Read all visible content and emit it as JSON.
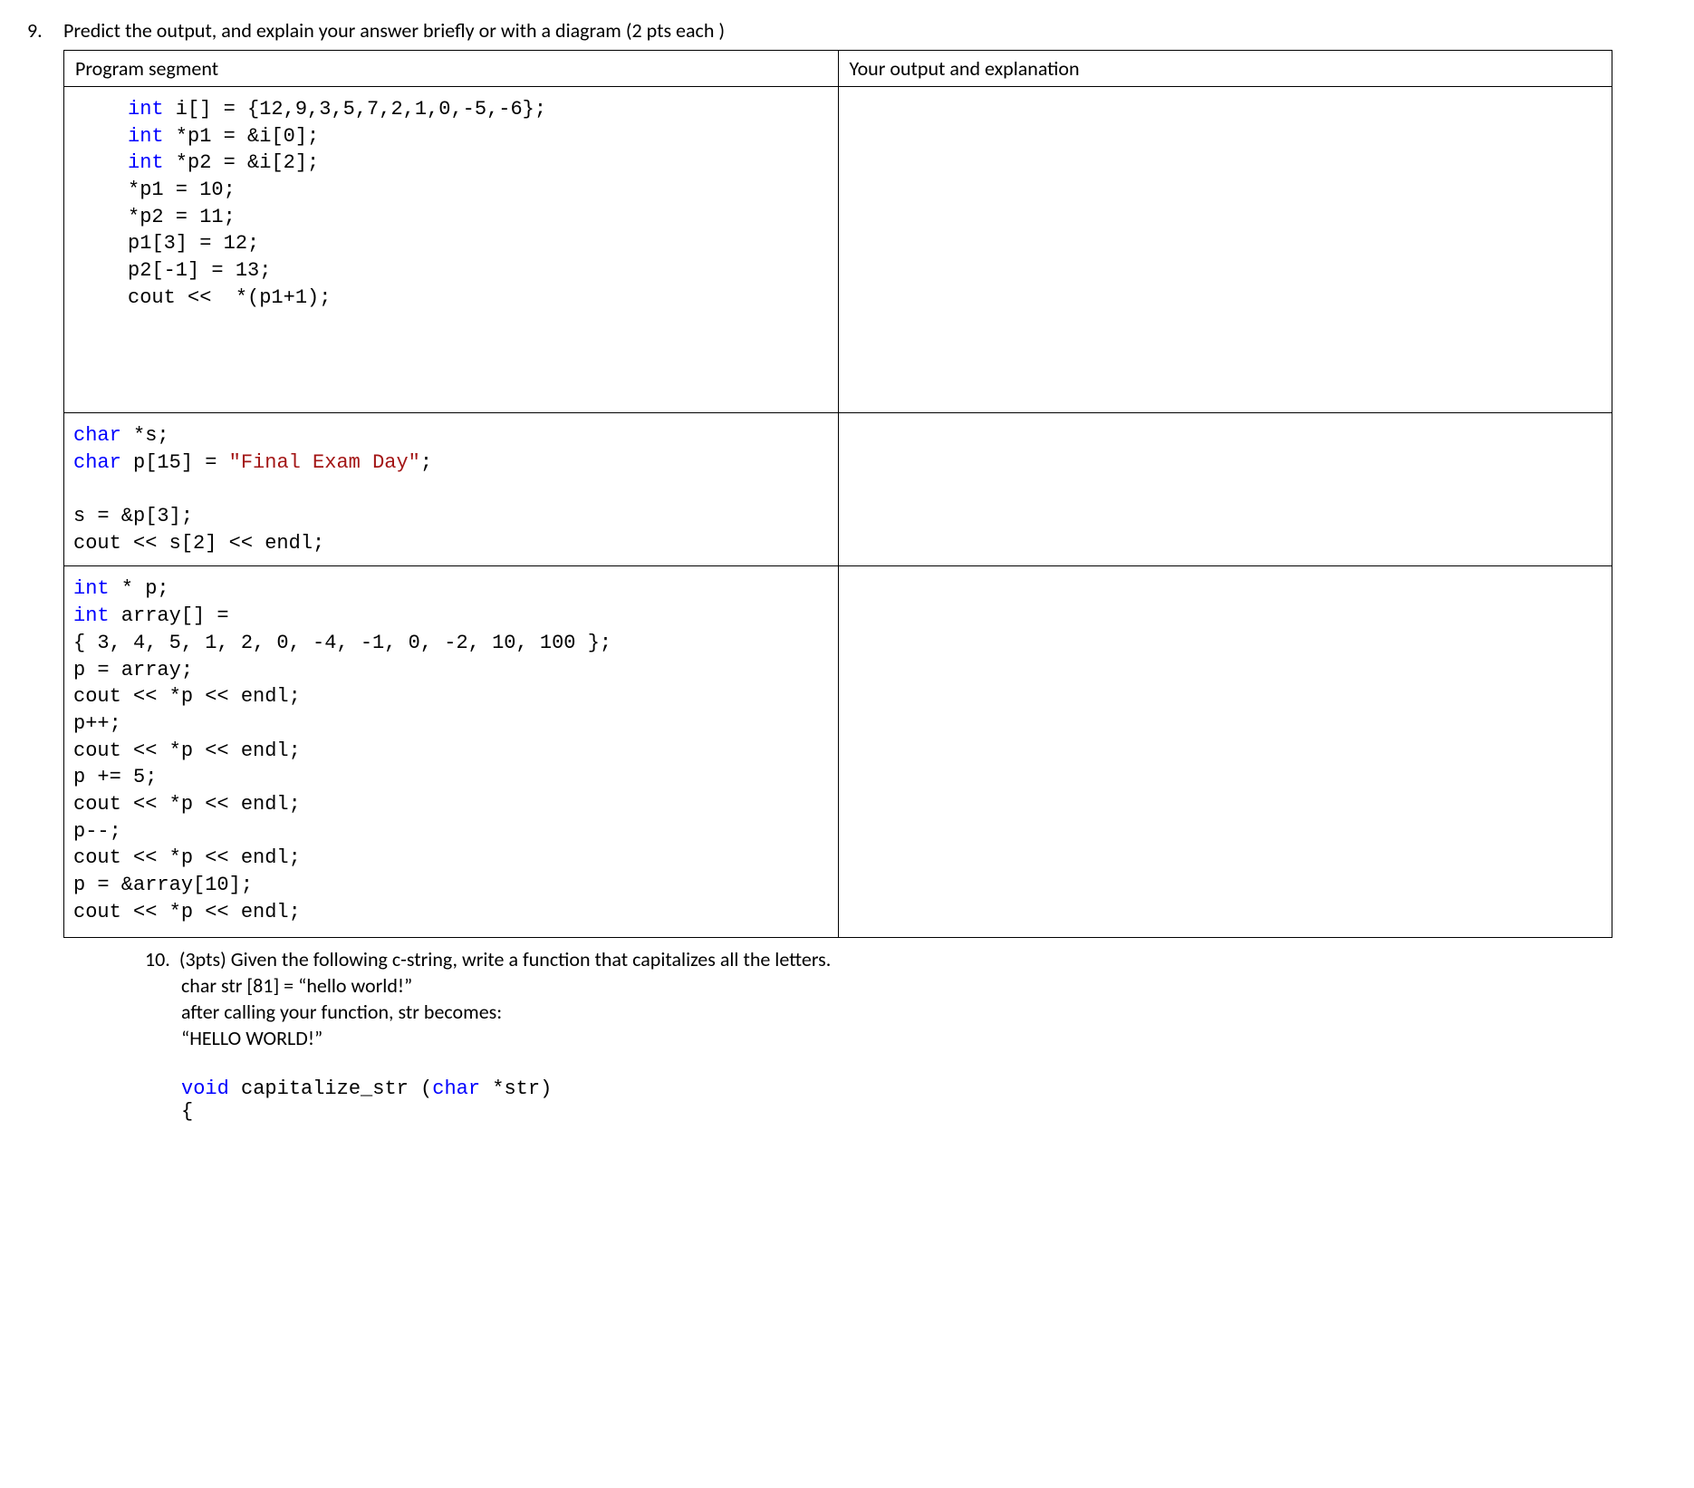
{
  "q9": {
    "number": "9.",
    "prompt": "Predict the output, and explain your answer briefly or with a diagram (2 pts each )",
    "header_left": "Program segment",
    "header_right": "Your output and explanation",
    "row1": {
      "l1a": "int",
      "l1b": " i[] = {12,9,3,5,7,2,1,0,-5,-6};",
      "l2a": "int",
      "l2b": " *p1 = &i[0];",
      "l3a": "int",
      "l3b": " *p2 = &i[2];",
      "l4": "*p1 = 10;",
      "l5": "*p2 = 11;",
      "l6": "p1[3] = 12;",
      "l7": "p2[-1] = 13;",
      "l8": "cout <<  *(p1+1);"
    },
    "row2": {
      "l1a": "char",
      "l1b": " *s;",
      "l2a": "char",
      "l2b": " p[15] = ",
      "l2c": "\"Final Exam Day\"",
      "l2d": ";",
      "l3": "s = &p[3];",
      "l4": "cout << s[2] << endl;"
    },
    "row3": {
      "l1a": "int",
      "l1b": " * p;",
      "l2a": "int",
      "l2b": " array[] =",
      "l3": "{ 3, 4, 5, 1, 2, 0, -4, -1, 0, -2, 10, 100 };",
      "l4": "p = array;",
      "l5": "cout << *p << endl;",
      "l6": "p++;",
      "l7": "cout << *p << endl;",
      "l8": "p += 5;",
      "l9": "cout << *p << endl;",
      "l10": "p--;",
      "l11": "cout << *p << endl;",
      "l12": "p = &array[10];",
      "l13": "cout << *p << endl;"
    }
  },
  "q10": {
    "number": "10.",
    "prompt": "(3pts) Given the following c-string, write a function that capitalizes all the letters.",
    "line1": "char str [81] = “hello world!”",
    "line2": "after calling your function, str becomes:",
    "line3": "“HELLO WORLD!”",
    "code_l1a": "void",
    "code_l1b": " capitalize_str (",
    "code_l1c": "char",
    "code_l1d": " *str)",
    "code_l2": "{"
  }
}
